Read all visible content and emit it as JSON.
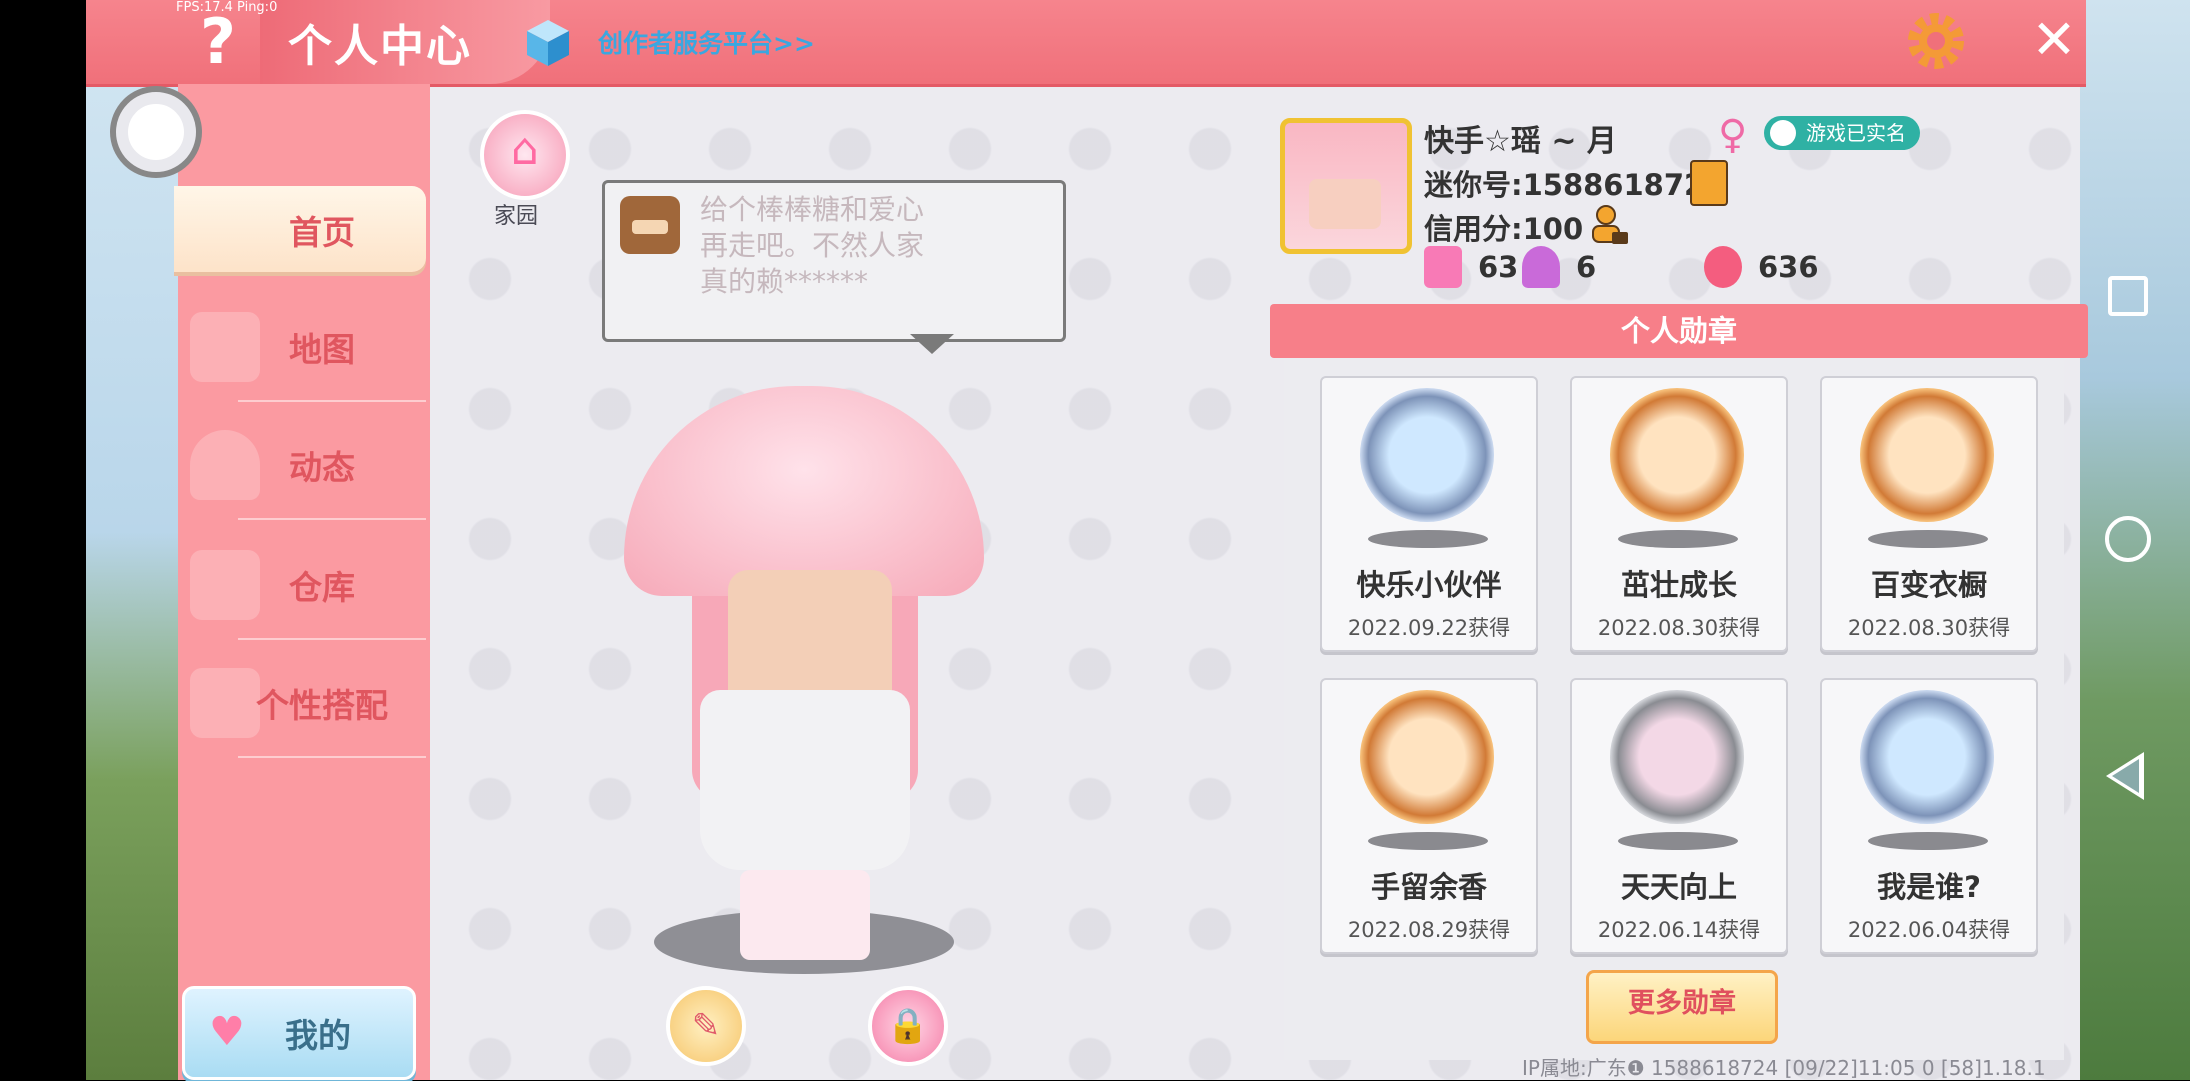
{
  "topbar": {
    "fps": "FPS:17.4  Ping:0",
    "help": "?",
    "title": "个人中心",
    "creator_link": "创作者服务平台>>",
    "close": "✕"
  },
  "sidebar": {
    "items": [
      {
        "label": "首页",
        "active": true
      },
      {
        "label": "地图"
      },
      {
        "label": "动态"
      },
      {
        "label": "仓库"
      },
      {
        "label": "个性搭配"
      }
    ],
    "my_button": "我的"
  },
  "avatar_area": {
    "home_label": "家园",
    "bubble_text": "给个棒棒糖和爱心再走吧。不然人家真的赖******"
  },
  "profile": {
    "nickname": "快手☆瑶 ~ 月",
    "gender_symbol": "♀",
    "realname_badge": "游戏已实名",
    "mini_id": "迷你号:1588618724",
    "credit": "信用分:100",
    "stats": [
      "63",
      "6",
      "636"
    ]
  },
  "medals": {
    "header": "个人勋章",
    "items": [
      {
        "name": "快乐小伙伴",
        "date": "2022.09.22获得",
        "style": "silver"
      },
      {
        "name": "茁壮成长",
        "date": "2022.08.30获得",
        "style": "bronze"
      },
      {
        "name": "百变衣橱",
        "date": "2022.08.30获得",
        "style": "bronze"
      },
      {
        "name": "手留余香",
        "date": "2022.08.29获得",
        "style": "bronze"
      },
      {
        "name": "天天向上",
        "date": "2022.06.14获得",
        "style": "gray"
      },
      {
        "name": "我是谁?",
        "date": "2022.06.04获得",
        "style": "silver"
      }
    ],
    "more_button": "更多勋章"
  },
  "footer": {
    "info": "IP属地:广东❶     1588618724    [09/22]11:05 0  [58]1.18.1"
  },
  "colors": {
    "accent": "#f0707a",
    "sidebar": "#fb9aa1",
    "link": "#3aa7e0"
  }
}
